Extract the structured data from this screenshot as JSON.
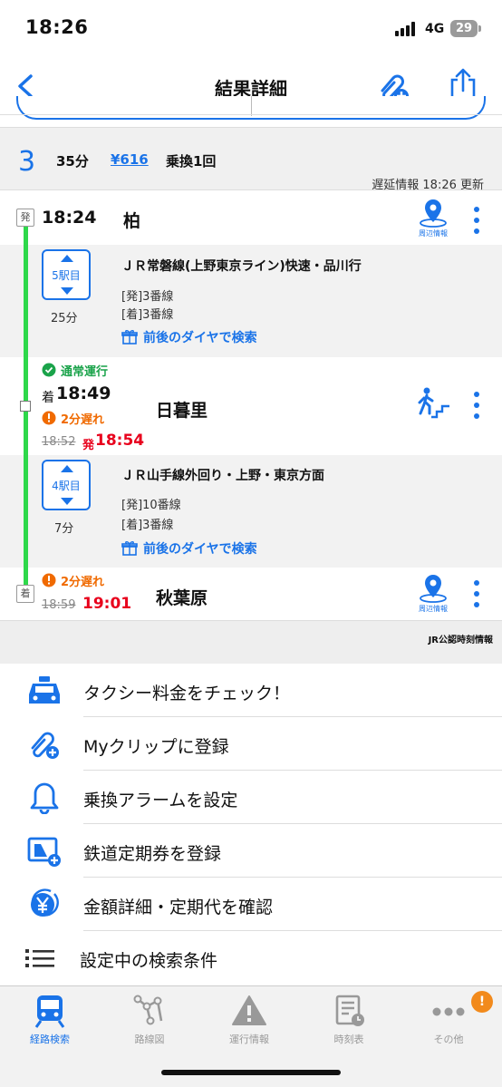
{
  "status_bar": {
    "time": "18:26",
    "network": "4G",
    "battery": "29"
  },
  "nav": {
    "title": "結果詳細"
  },
  "summary": {
    "index": "3",
    "duration": "35分",
    "fare": "¥616",
    "transfers": "乗換1回",
    "delay_info": "遅延情報 18:26 更新"
  },
  "route": {
    "departure": {
      "badge": "発",
      "time": "18:24",
      "station": "柏",
      "info_label": "周辺情報"
    },
    "segment1": {
      "stops": "5駅目",
      "minutes": "25分",
      "line": "ＪＲ常磐線(上野東京ライン)快速・品川行",
      "dep_track": "[発]3番線",
      "arr_track": "[着]3番線",
      "search": "前後のダイヤで検索"
    },
    "transfer": {
      "normal": "通常運行",
      "arr_prefix": "着",
      "arr_time": "18:49",
      "station": "日暮里",
      "delay": "2分遅れ",
      "orig_time": "18:52",
      "dep_prefix": "発",
      "new_time": "18:54"
    },
    "segment2": {
      "stops": "4駅目",
      "minutes": "7分",
      "line": "ＪＲ山手線外回り・上野・東京方面",
      "dep_track": "[発]10番線",
      "arr_track": "[着]3番線",
      "search": "前後のダイヤで検索"
    },
    "arrival": {
      "badge": "着",
      "delay": "2分遅れ",
      "orig_time": "18:59",
      "new_time": "19:01",
      "station": "秋葉原",
      "info_label": "周辺情報"
    }
  },
  "credit": "JR公認時刻情報",
  "menu": [
    {
      "label": "タクシー料金をチェック！",
      "icon": "taxi-icon"
    },
    {
      "label": "Myクリップに登録",
      "icon": "clip-add-icon"
    },
    {
      "label": "乗換アラームを設定",
      "icon": "bell-icon"
    },
    {
      "label": "鉄道定期券を登録",
      "icon": "pass-card-icon"
    },
    {
      "label": "金額詳細・定期代を確認",
      "icon": "yen-icon"
    },
    {
      "label": "設定中の検索条件",
      "icon": "list-icon"
    }
  ],
  "tabs": [
    {
      "label": "経路検索",
      "active": true
    },
    {
      "label": "路線図",
      "active": false
    },
    {
      "label": "運行情報",
      "active": false
    },
    {
      "label": "時刻表",
      "active": false
    },
    {
      "label": "その他",
      "active": false
    }
  ],
  "tab_badge": "!",
  "colors": {
    "accent": "#1a73e8",
    "line_green": "#2ed84a",
    "delay_orange": "#f06a00",
    "delay_red": "#e8001c"
  }
}
